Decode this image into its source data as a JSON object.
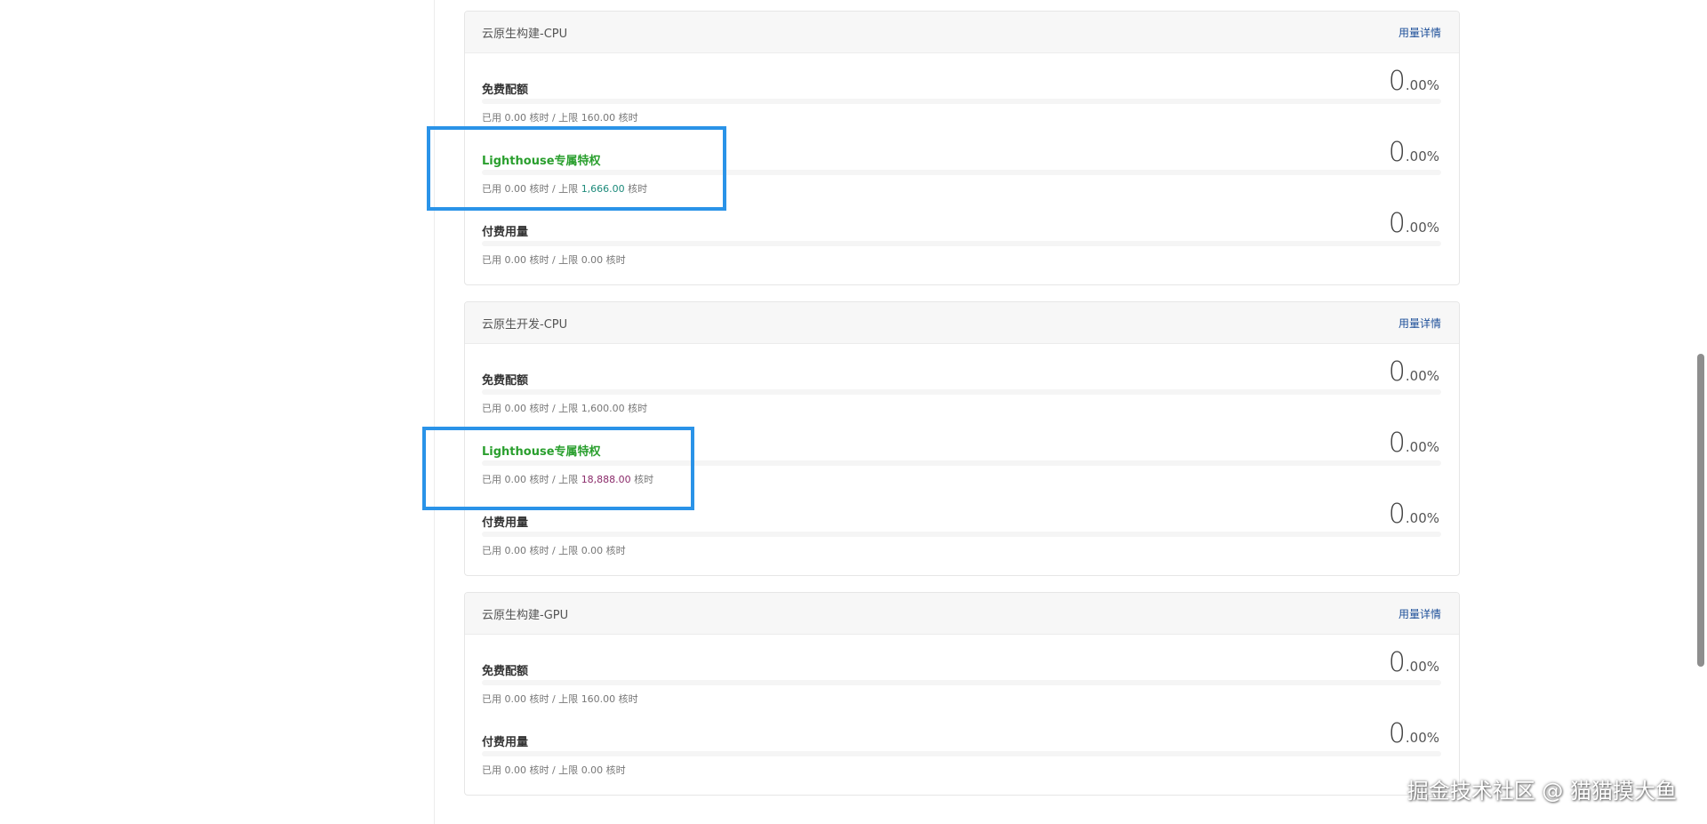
{
  "cards": [
    {
      "title": "云原生构建-CPU",
      "link": "用量详情",
      "quotas": [
        {
          "name": "免费配额",
          "highlight": false,
          "pct_int": "0",
          "pct_dec": ".00%",
          "used": "已用 0.00 核时 / 上限 ",
          "limit": "160.00",
          "unit": " 核时",
          "limit_color": "",
          "progress": 0
        },
        {
          "name": "Lighthouse专属特权",
          "highlight": true,
          "pct_int": "0",
          "pct_dec": ".00%",
          "used": "已用 0.00 核时 / 上限 ",
          "limit": "1,666.00",
          "unit": " 核时",
          "limit_color": "teal",
          "progress": 0
        },
        {
          "name": "付费用量",
          "highlight": false,
          "pct_int": "0",
          "pct_dec": ".00%",
          "used": "已用 0.00 核时 / 上限 ",
          "limit": "0.00",
          "unit": " 核时",
          "limit_color": "",
          "progress": 0
        }
      ]
    },
    {
      "title": "云原生开发-CPU",
      "link": "用量详情",
      "quotas": [
        {
          "name": "免费配额",
          "highlight": false,
          "pct_int": "0",
          "pct_dec": ".00%",
          "used": "已用 0.00 核时 / 上限 ",
          "limit": "1,600.00",
          "unit": " 核时",
          "limit_color": "",
          "progress": 0
        },
        {
          "name": "Lighthouse专属特权",
          "highlight": true,
          "pct_int": "0",
          "pct_dec": ".00%",
          "used": "已用 0.00 核时 / 上限 ",
          "limit": "18,888.00",
          "unit": " 核时",
          "limit_color": "purple",
          "progress": 0
        },
        {
          "name": "付费用量",
          "highlight": false,
          "pct_int": "0",
          "pct_dec": ".00%",
          "used": "已用 0.00 核时 / 上限 ",
          "limit": "0.00",
          "unit": " 核时",
          "limit_color": "",
          "progress": 0
        }
      ]
    },
    {
      "title": "云原生构建-GPU",
      "link": "用量详情",
      "quotas": [
        {
          "name": "免费配额",
          "highlight": false,
          "pct_int": "0",
          "pct_dec": ".00%",
          "used": "已用 0.00 核时 / 上限 ",
          "limit": "160.00",
          "unit": " 核时",
          "limit_color": "",
          "progress": 0
        },
        {
          "name": "付费用量",
          "highlight": false,
          "pct_int": "0",
          "pct_dec": ".00%",
          "used": "已用 0.00 核时 / 上限 ",
          "limit": "0.00",
          "unit": " 核时",
          "limit_color": "",
          "progress": 0
        }
      ]
    }
  ],
  "colors": {
    "highlight_border": "#2a93e8",
    "privilege_green": "#2a9f2e",
    "link_blue": "#1d4f99",
    "limit_teal": "#1c8a7a",
    "limit_purple": "#8b2c6b"
  },
  "watermark": "掘金技术社区 @ 猫猫摸大鱼"
}
